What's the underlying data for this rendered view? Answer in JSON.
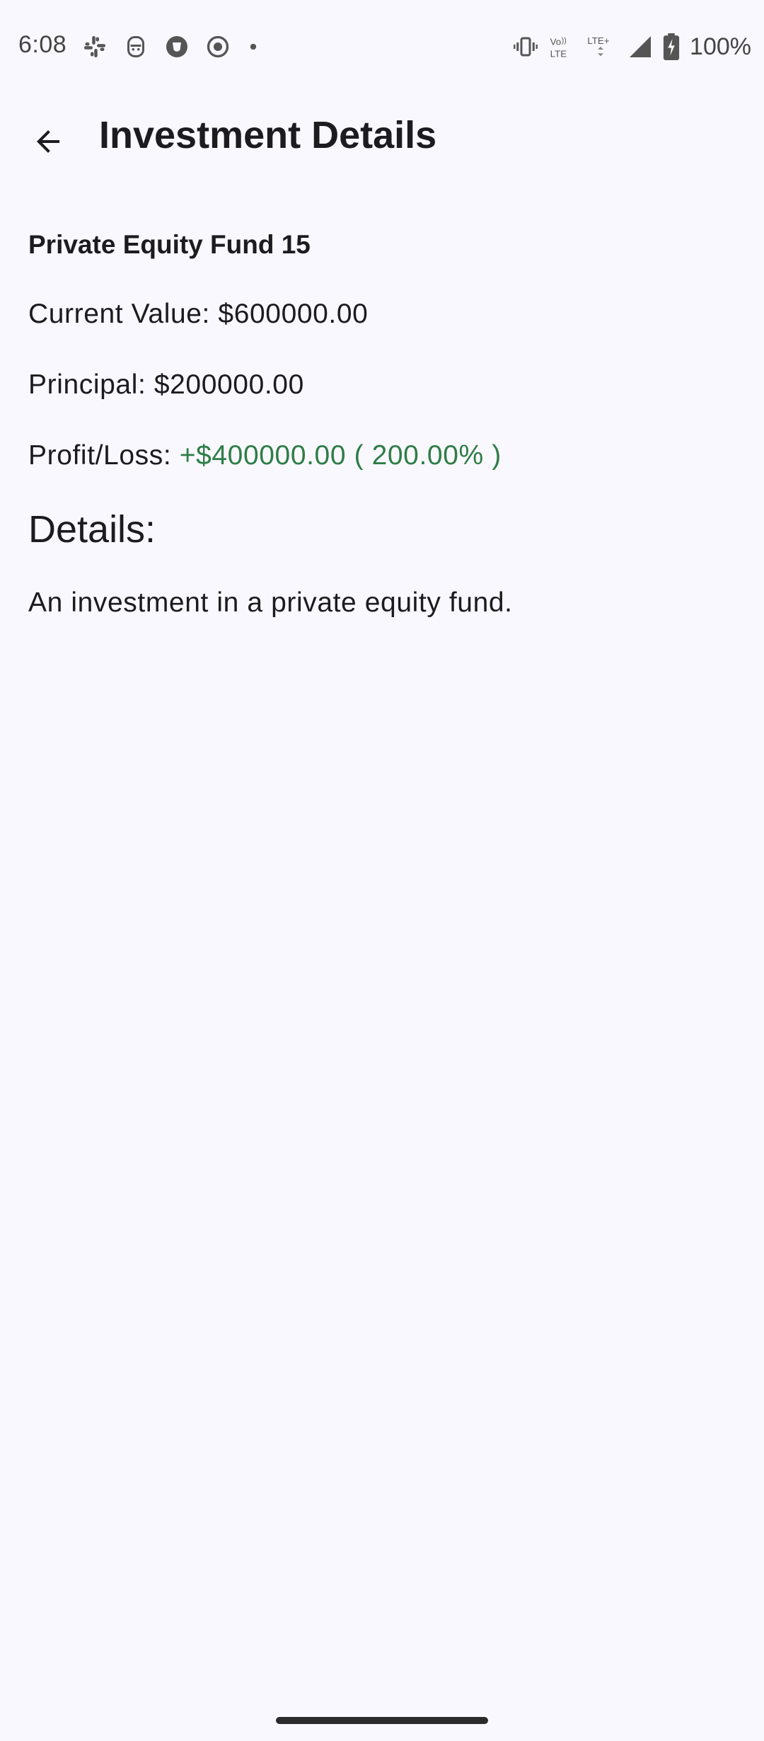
{
  "status_bar": {
    "time": "6:08",
    "left_icons": [
      "slack-icon",
      "robot-face-icon",
      "shield-browser-icon",
      "record-icon",
      "dot-icon"
    ],
    "right_icons": [
      "vibrate-icon",
      "volte-icon",
      "lte-plus-icon",
      "signal-icon",
      "battery-charging-icon"
    ],
    "battery": "100%"
  },
  "app_bar": {
    "title": "Investment Details",
    "back_icon": "arrow-back-icon"
  },
  "investment": {
    "name": "Private Equity Fund 15",
    "current_value_label": "Current Value: ",
    "current_value": "$600000.00",
    "principal_label": "Principal: ",
    "principal": "$200000.00",
    "profit_label": "Profit/Loss: ",
    "profit_value": "+$400000.00 ( 200.00% )",
    "details_heading": "Details:",
    "details_text": "An investment in a private equity fund."
  },
  "colors": {
    "background": "#f9f8fe",
    "text": "#1c1b1f",
    "profit_positive": "#2e7d46"
  }
}
